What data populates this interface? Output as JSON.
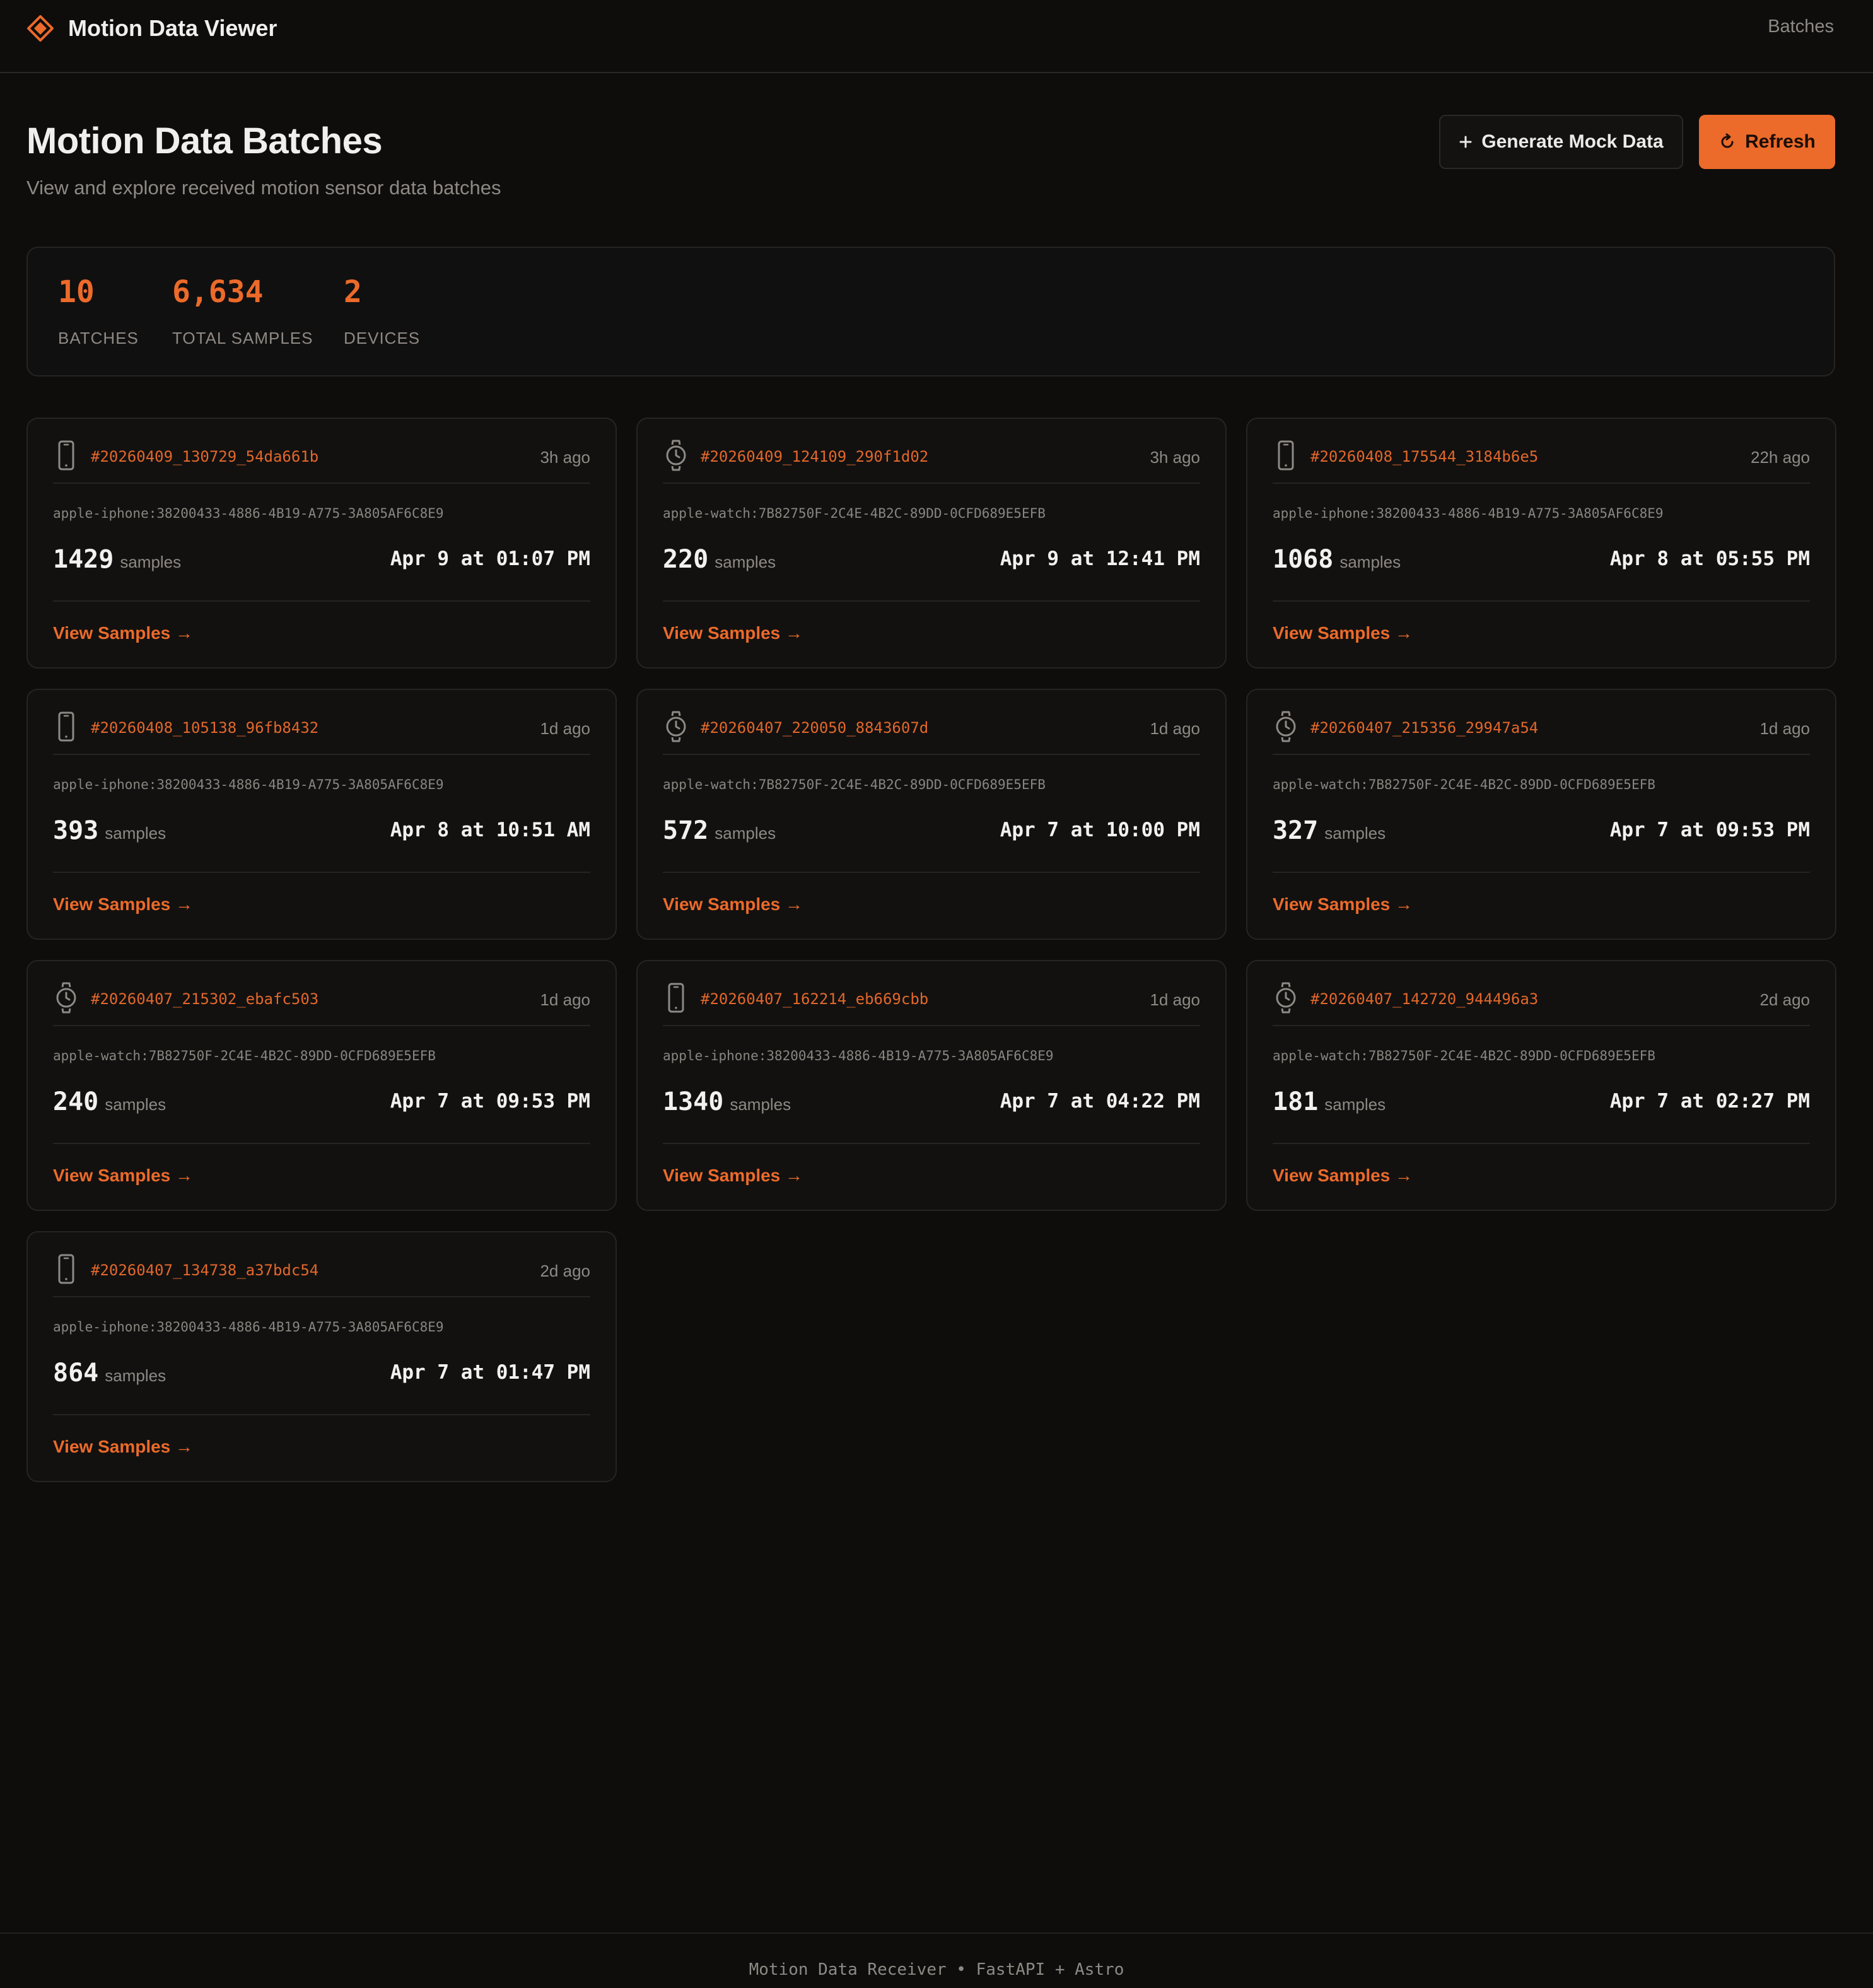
{
  "app": {
    "name": "Motion Data Viewer",
    "nav_link": "Batches",
    "logo_icon": "diamond-logo-icon"
  },
  "header": {
    "title": "Motion Data Batches",
    "subtitle": "View and explore received motion sensor data batches",
    "generate_button": "Generate Mock Data",
    "refresh_button": "Refresh"
  },
  "stats": [
    {
      "value": "10",
      "label": "BATCHES"
    },
    {
      "value": "6,634",
      "label": "TOTAL SAMPLES"
    },
    {
      "value": "2",
      "label": "DEVICES"
    }
  ],
  "colors": {
    "accent": "#ec6a2a",
    "background": "#0e0d0c",
    "card": "#121110",
    "border": "#272422",
    "muted": "#8e8984"
  },
  "batches": [
    {
      "id": "#20260409_130729_54da661b",
      "ago": "3h ago",
      "device_type": "phone",
      "device": "apple-iphone:38200433-4886-4B19-A775-3A805AF6C8E9",
      "samples": "1429",
      "unit": "samples",
      "date": "Apr 9 at 01:07 PM",
      "link": "View Samples →"
    },
    {
      "id": "#20260409_124109_290f1d02",
      "ago": "3h ago",
      "device_type": "watch",
      "device": "apple-watch:7B82750F-2C4E-4B2C-89DD-0CFD689E5EFB",
      "samples": "220",
      "unit": "samples",
      "date": "Apr 9 at 12:41 PM",
      "link": "View Samples →"
    },
    {
      "id": "#20260408_175544_3184b6e5",
      "ago": "22h ago",
      "device_type": "phone",
      "device": "apple-iphone:38200433-4886-4B19-A775-3A805AF6C8E9",
      "samples": "1068",
      "unit": "samples",
      "date": "Apr 8 at 05:55 PM",
      "link": "View Samples →"
    },
    {
      "id": "#20260408_105138_96fb8432",
      "ago": "1d ago",
      "device_type": "phone",
      "device": "apple-iphone:38200433-4886-4B19-A775-3A805AF6C8E9",
      "samples": "393",
      "unit": "samples",
      "date": "Apr 8 at 10:51 AM",
      "link": "View Samples →"
    },
    {
      "id": "#20260407_220050_8843607d",
      "ago": "1d ago",
      "device_type": "watch",
      "device": "apple-watch:7B82750F-2C4E-4B2C-89DD-0CFD689E5EFB",
      "samples": "572",
      "unit": "samples",
      "date": "Apr 7 at 10:00 PM",
      "link": "View Samples →"
    },
    {
      "id": "#20260407_215356_29947a54",
      "ago": "1d ago",
      "device_type": "watch",
      "device": "apple-watch:7B82750F-2C4E-4B2C-89DD-0CFD689E5EFB",
      "samples": "327",
      "unit": "samples",
      "date": "Apr 7 at 09:53 PM",
      "link": "View Samples →"
    },
    {
      "id": "#20260407_215302_ebafc503",
      "ago": "1d ago",
      "device_type": "watch",
      "device": "apple-watch:7B82750F-2C4E-4B2C-89DD-0CFD689E5EFB",
      "samples": "240",
      "unit": "samples",
      "date": "Apr 7 at 09:53 PM",
      "link": "View Samples →"
    },
    {
      "id": "#20260407_162214_eb669cbb",
      "ago": "1d ago",
      "device_type": "phone",
      "device": "apple-iphone:38200433-4886-4B19-A775-3A805AF6C8E9",
      "samples": "1340",
      "unit": "samples",
      "date": "Apr 7 at 04:22 PM",
      "link": "View Samples →"
    },
    {
      "id": "#20260407_142720_944496a3",
      "ago": "2d ago",
      "device_type": "watch",
      "device": "apple-watch:7B82750F-2C4E-4B2C-89DD-0CFD689E5EFB",
      "samples": "181",
      "unit": "samples",
      "date": "Apr 7 at 02:27 PM",
      "link": "View Samples →"
    },
    {
      "id": "#20260407_134738_a37bdc54",
      "ago": "2d ago",
      "device_type": "phone",
      "device": "apple-iphone:38200433-4886-4B19-A775-3A805AF6C8E9",
      "samples": "864",
      "unit": "samples",
      "date": "Apr 7 at 01:47 PM",
      "link": "View Samples →"
    }
  ],
  "footer": {
    "text": "Motion Data Receiver • FastAPI + Astro"
  }
}
